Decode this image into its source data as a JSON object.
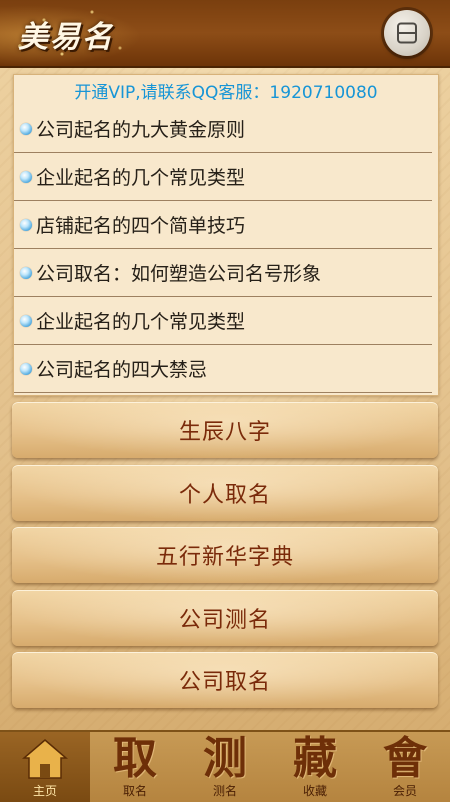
{
  "header": {
    "app_title": "美易名",
    "menu_icon": "menu-list-icon"
  },
  "vip_notice": "开通VIP,请联系QQ客服：1920710080",
  "articles": [
    "公司起名的九大黄金原则",
    "企业起名的几个常见类型",
    "店铺起名的四个简单技巧",
    "公司取名：如何塑造公司名号形象",
    "企业起名的几个常见类型",
    "公司起名的四大禁忌"
  ],
  "menu_buttons": [
    "生辰八字",
    "个人取名",
    "五行新华字典",
    "公司测名",
    "公司取名"
  ],
  "bottom_nav": [
    {
      "glyph": "",
      "icon": "home-icon",
      "label": "主页",
      "active": true
    },
    {
      "glyph": "取",
      "icon": "",
      "label": "取名",
      "active": false
    },
    {
      "glyph": "测",
      "icon": "",
      "label": "测名",
      "active": false
    },
    {
      "glyph": "藏",
      "icon": "",
      "label": "收藏",
      "active": false
    },
    {
      "glyph": "會",
      "icon": "",
      "label": "会员",
      "active": false
    }
  ],
  "colors": {
    "header": "#8d4d17",
    "vip_text": "#1795d6",
    "button_text": "#7a2a0a",
    "panel": "#f8e8cc"
  }
}
